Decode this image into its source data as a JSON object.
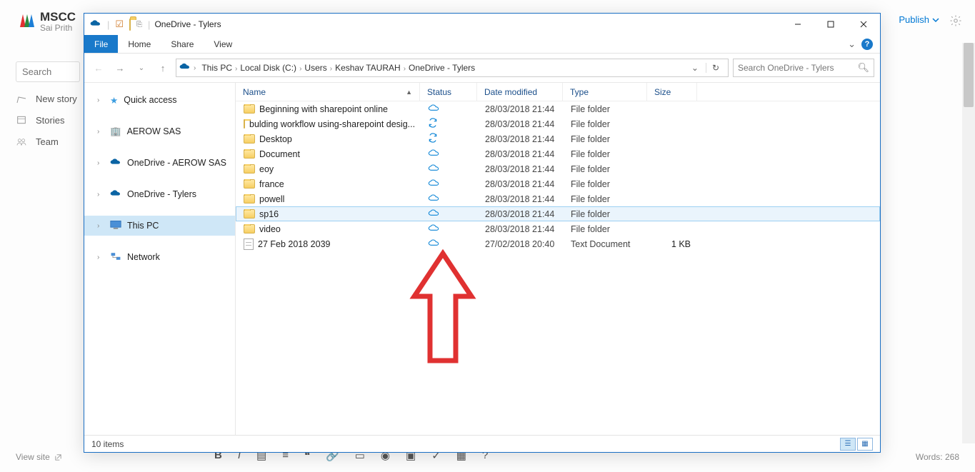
{
  "background": {
    "logo_main": "MSCC",
    "logo_sub": "Sai Prith",
    "logo_acronym": "SCC",
    "publish": "Publish",
    "search_placeholder": "Search",
    "nav": [
      {
        "label": "New story"
      },
      {
        "label": "Stories"
      },
      {
        "label": "Team"
      }
    ],
    "footer_left": "View site",
    "footer_right": "Words: 268"
  },
  "explorer": {
    "title": "OneDrive - Tylers",
    "tabs": {
      "file": "File",
      "home": "Home",
      "share": "Share",
      "view": "View"
    },
    "breadcrumb": [
      "This PC",
      "Local Disk (C:)",
      "Users",
      "Keshav TAURAH",
      "OneDrive - Tylers"
    ],
    "search_placeholder": "Search OneDrive - Tylers",
    "nav_pane": [
      {
        "kind": "star",
        "label": "Quick access",
        "expandable": true
      },
      {
        "kind": "gap"
      },
      {
        "kind": "building",
        "label": "AEROW SAS",
        "expandable": true
      },
      {
        "kind": "gap"
      },
      {
        "kind": "cloud",
        "label": "OneDrive - AEROW SAS",
        "expandable": true
      },
      {
        "kind": "gap"
      },
      {
        "kind": "cloud",
        "label": "OneDrive - Tylers",
        "expandable": true
      },
      {
        "kind": "gap"
      },
      {
        "kind": "pc",
        "label": "This PC",
        "expandable": true,
        "selected": true
      },
      {
        "kind": "gap"
      },
      {
        "kind": "net",
        "label": "Network",
        "expandable": true
      }
    ],
    "columns": {
      "name": "Name",
      "status": "Status",
      "date": "Date modified",
      "type": "Type",
      "size": "Size"
    },
    "rows": [
      {
        "icon": "folder",
        "name": "Beginning with sharepoint online",
        "status": "cloud",
        "date": "28/03/2018 21:44",
        "type": "File folder",
        "size": ""
      },
      {
        "icon": "folder",
        "name": "bulding workflow using-sharepoint desig...",
        "status": "sync",
        "date": "28/03/2018 21:44",
        "type": "File folder",
        "size": ""
      },
      {
        "icon": "folder",
        "name": "Desktop",
        "status": "sync",
        "date": "28/03/2018 21:44",
        "type": "File folder",
        "size": ""
      },
      {
        "icon": "folder",
        "name": "Document",
        "status": "cloud",
        "date": "28/03/2018 21:44",
        "type": "File folder",
        "size": ""
      },
      {
        "icon": "folder",
        "name": "eoy",
        "status": "cloud",
        "date": "28/03/2018 21:44",
        "type": "File folder",
        "size": ""
      },
      {
        "icon": "folder",
        "name": "france",
        "status": "cloud",
        "date": "28/03/2018 21:44",
        "type": "File folder",
        "size": ""
      },
      {
        "icon": "folder",
        "name": "powell",
        "status": "cloud",
        "date": "28/03/2018 21:44",
        "type": "File folder",
        "size": ""
      },
      {
        "icon": "folder",
        "name": "sp16",
        "status": "cloud",
        "date": "28/03/2018 21:44",
        "type": "File folder",
        "size": "",
        "hover": true
      },
      {
        "icon": "folder",
        "name": "video",
        "status": "cloud",
        "date": "28/03/2018 21:44",
        "type": "File folder",
        "size": ""
      },
      {
        "icon": "txt",
        "name": "27 Feb 2018 2039",
        "status": "cloud",
        "date": "27/02/2018 20:40",
        "type": "Text Document",
        "size": "1 KB"
      }
    ],
    "status_text": "10 items"
  }
}
